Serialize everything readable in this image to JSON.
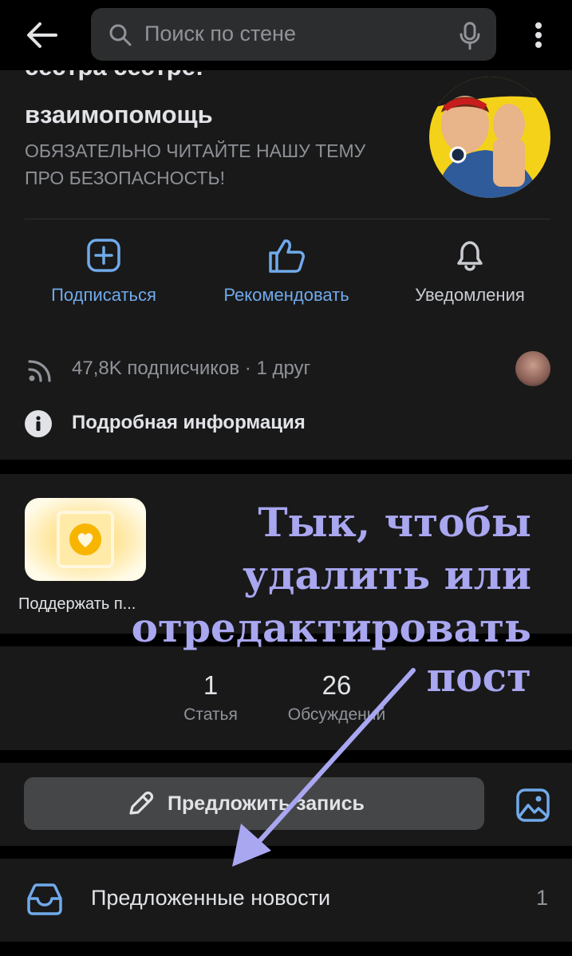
{
  "header": {
    "back_icon": "arrow-left-icon",
    "search_placeholder": "Поиск по стене",
    "search_icon": "search-icon",
    "mic_icon": "microphone-icon",
    "more_icon": "more-vertical-icon"
  },
  "group": {
    "title_line1": "сестра сестре!",
    "title_line2": "взаимопомощь",
    "status": "ОБЯЗАТЕЛЬНО ЧИТАЙТЕ НАШУ ТЕМУ ПРО БЕЗОПАСНОСТЬ!",
    "actions": [
      {
        "label": "Подписаться",
        "icon": "plus-square-icon"
      },
      {
        "label": "Рекомендовать",
        "icon": "thumbs-up-icon"
      },
      {
        "label": "Уведомления",
        "icon": "bell-icon"
      }
    ],
    "subscribers": "47,8K подписчиков · 1 друг",
    "info": "Подробная информация"
  },
  "app": {
    "label": "Поддержать п..."
  },
  "counters": [
    {
      "value": "1",
      "caption": "Статья"
    },
    {
      "value": "26",
      "caption": "Обсуждений"
    }
  ],
  "suggest": {
    "label": "Предложить запись"
  },
  "suggested_news": {
    "label": "Предложенные новости",
    "count": "1"
  },
  "annotation": {
    "line1": "Тык, чтобы",
    "line2": "удалить или",
    "line3": "отредактировать",
    "line4": "пост"
  },
  "colors": {
    "background": "#000000",
    "card": "#19191a",
    "accent": "#71aaeb",
    "annotation": "#a9a7f0"
  }
}
